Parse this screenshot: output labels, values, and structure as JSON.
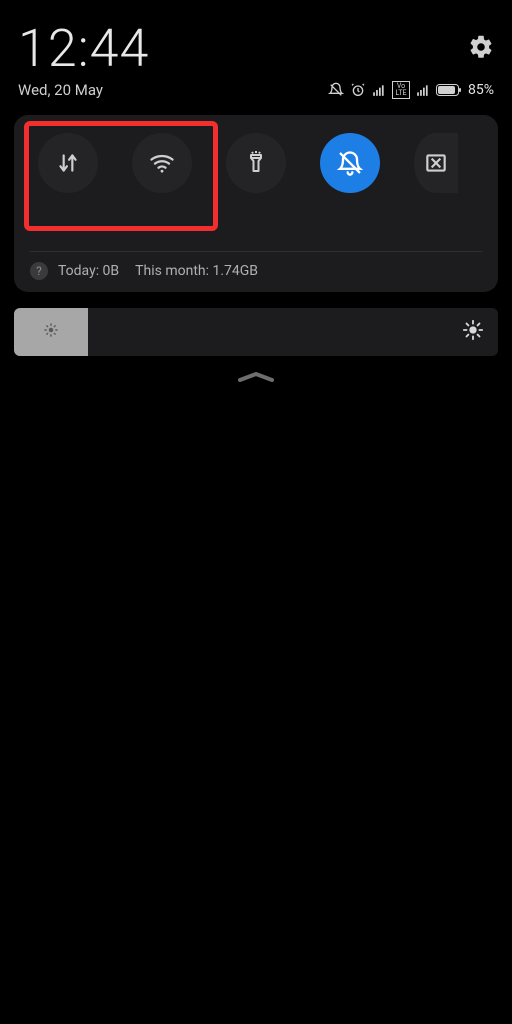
{
  "status": {
    "time": "12:44",
    "date": "Wed, 20 May",
    "battery_pct": "85%",
    "volte_label": "Vo LTE"
  },
  "quicksettings": {
    "tiles": {
      "data": "mobile-data",
      "wifi": "wifi",
      "flashlight": "flashlight",
      "dnd": "do-not-disturb",
      "screenshot": "screenshot"
    }
  },
  "data_usage": {
    "today": "Today: 0B",
    "month": "This month: 1.74GB",
    "help": "?"
  },
  "colors": {
    "accent": "#1d7ee6",
    "highlight": "#f22e2e"
  }
}
